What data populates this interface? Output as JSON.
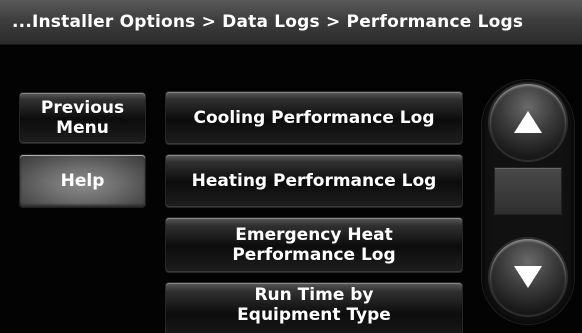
{
  "header": {
    "breadcrumb": "...Installer Options > Data Logs > Performance Logs"
  },
  "left_buttons": {
    "previous_menu": [
      "Previous",
      "Menu"
    ],
    "help": "Help"
  },
  "menu": {
    "cooling": "Cooling Performance Log",
    "heating": "Heating Performance Log",
    "emergency": [
      "Emergency Heat",
      "Performance Log"
    ],
    "runtime": [
      "Run Time by",
      "Equipment Type"
    ]
  },
  "scroll": {
    "up_icon": "arrow-up-icon",
    "down_icon": "arrow-down-icon"
  }
}
